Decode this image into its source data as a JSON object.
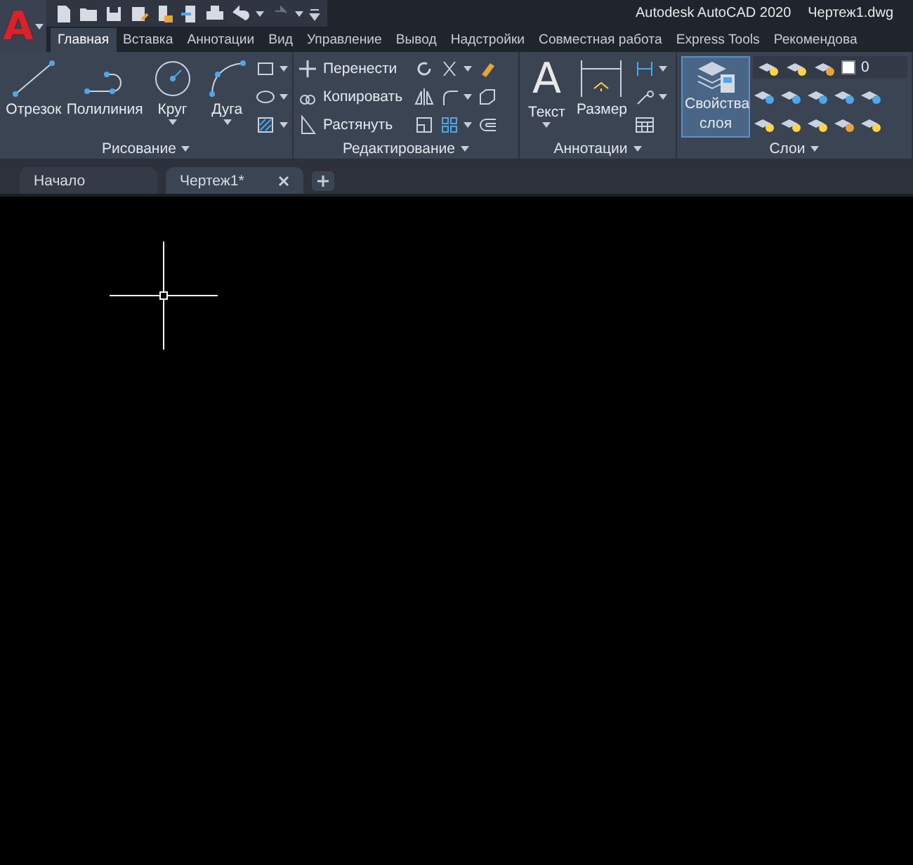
{
  "app_button": {
    "letter": "A"
  },
  "title": {
    "app": "Autodesk AutoCAD 2020",
    "file": "Чертеж1.dwg"
  },
  "ribbon_tabs": [
    {
      "label": "Главная",
      "selected": true
    },
    {
      "label": "Вставка",
      "selected": false
    },
    {
      "label": "Аннотации",
      "selected": false
    },
    {
      "label": "Вид",
      "selected": false
    },
    {
      "label": "Управление",
      "selected": false
    },
    {
      "label": "Вывод",
      "selected": false
    },
    {
      "label": "Надстройки",
      "selected": false
    },
    {
      "label": "Совместная работа",
      "selected": false
    },
    {
      "label": "Express Tools",
      "selected": false
    },
    {
      "label": "Рекомендова",
      "selected": false
    }
  ],
  "panels": {
    "draw": {
      "title": "Рисование",
      "tools": [
        {
          "label": "Отрезок",
          "dropdown": false
        },
        {
          "label": "Полилиния",
          "dropdown": false
        },
        {
          "label": "Круг",
          "dropdown": true
        },
        {
          "label": "Дуга",
          "dropdown": true
        }
      ]
    },
    "modify": {
      "title": "Редактирование",
      "commands": [
        "Перенести",
        "Копировать",
        "Растянуть"
      ]
    },
    "annotation": {
      "title": "Аннотации",
      "text_tool": {
        "label": "Текст",
        "icon_letter": "A"
      },
      "dimension_tool": {
        "label": "Размер"
      }
    },
    "layers": {
      "title": "Слои",
      "properties_button": {
        "label": "Свойства слоя",
        "active": true
      },
      "current_layer": "0"
    }
  },
  "document_tabs": [
    {
      "label": "Начало",
      "selected": false,
      "closable": false
    },
    {
      "label": "Чертеж1*",
      "selected": true,
      "closable": true
    }
  ]
}
